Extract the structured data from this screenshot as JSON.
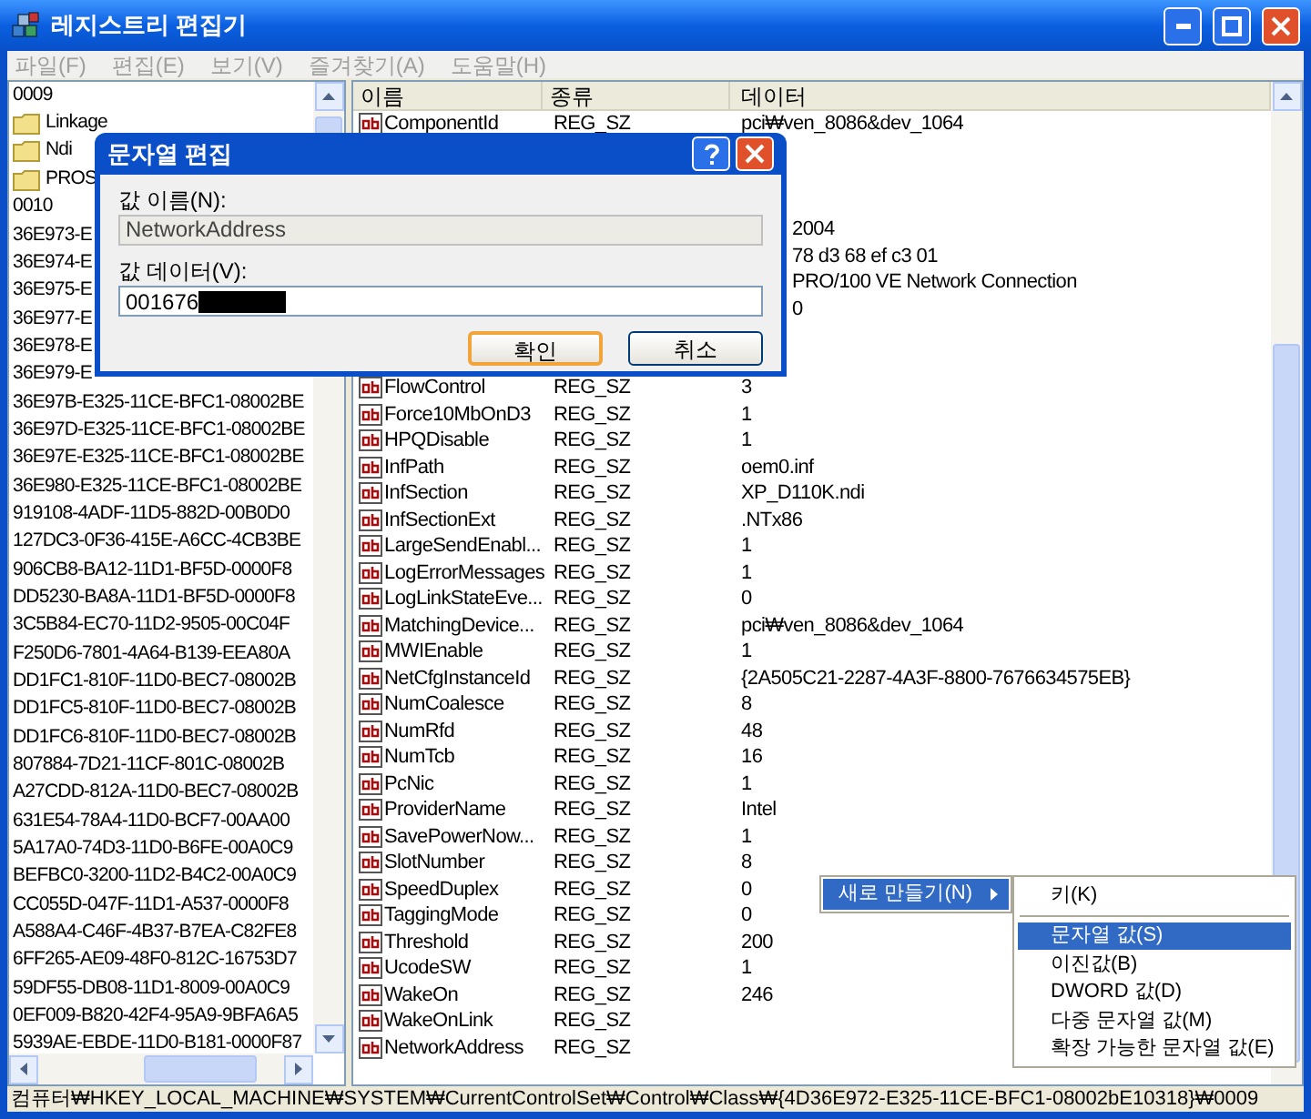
{
  "window": {
    "title": "레지스트리 편집기"
  },
  "menu_bar": [
    {
      "label": "파일(F)",
      "disabled": true
    },
    {
      "label": "편집(E)",
      "disabled": true
    },
    {
      "label": "보기(V)",
      "disabled": true
    },
    {
      "label": "즐겨찾기(A)",
      "disabled": true
    },
    {
      "label": "도움말(H)",
      "disabled": true
    }
  ],
  "tree": {
    "items": [
      {
        "kind": "key",
        "label": "0009"
      },
      {
        "kind": "folder",
        "label": "Linkage"
      },
      {
        "kind": "folder",
        "label": "Ndi"
      },
      {
        "kind": "folder",
        "label": "PROS"
      },
      {
        "kind": "key",
        "label": "0010"
      },
      {
        "kind": "key",
        "label": "36E973-E"
      },
      {
        "kind": "key",
        "label": "36E974-E"
      },
      {
        "kind": "key",
        "label": "36E975-E"
      },
      {
        "kind": "key",
        "label": "36E977-E"
      },
      {
        "kind": "key",
        "label": "36E978-E"
      },
      {
        "kind": "key",
        "label": "36E979-E"
      },
      {
        "kind": "key",
        "label": "36E97B-E325-11CE-BFC1-08002BE"
      },
      {
        "kind": "key",
        "label": "36E97D-E325-11CE-BFC1-08002BE"
      },
      {
        "kind": "key",
        "label": "36E97E-E325-11CE-BFC1-08002BE"
      },
      {
        "kind": "key",
        "label": "36E980-E325-11CE-BFC1-08002BE"
      },
      {
        "kind": "key",
        "label": "919108-4ADF-11D5-882D-00B0D0"
      },
      {
        "kind": "key",
        "label": "127DC3-0F36-415E-A6CC-4CB3BE"
      },
      {
        "kind": "key",
        "label": "906CB8-BA12-11D1-BF5D-0000F8"
      },
      {
        "kind": "key",
        "label": "DD5230-BA8A-11D1-BF5D-0000F8"
      },
      {
        "kind": "key",
        "label": "3C5B84-EC70-11D2-9505-00C04F"
      },
      {
        "kind": "key",
        "label": "F250D6-7801-4A64-B139-EEA80A"
      },
      {
        "kind": "key",
        "label": "DD1FC1-810F-11D0-BEC7-08002B"
      },
      {
        "kind": "key",
        "label": "DD1FC5-810F-11D0-BEC7-08002B"
      },
      {
        "kind": "key",
        "label": "DD1FC6-810F-11D0-BEC7-08002B"
      },
      {
        "kind": "key",
        "label": "807884-7D21-11CF-801C-08002B"
      },
      {
        "kind": "key",
        "label": "A27CDD-812A-11D0-BEC7-08002B"
      },
      {
        "kind": "key",
        "label": "631E54-78A4-11D0-BCF7-00AA00"
      },
      {
        "kind": "key",
        "label": "5A17A0-74D3-11D0-B6FE-00A0C9"
      },
      {
        "kind": "key",
        "label": "BEFBC0-3200-11D2-B4C2-00A0C9"
      },
      {
        "kind": "key",
        "label": "CC055D-047F-11D1-A537-0000F8"
      },
      {
        "kind": "key",
        "label": "A588A4-C46F-4B37-B7EA-C82FE8"
      },
      {
        "kind": "key",
        "label": "6FF265-AE09-48F0-812C-16753D7"
      },
      {
        "kind": "key",
        "label": "59DF55-DB08-11D1-8009-00A0C9"
      },
      {
        "kind": "key",
        "label": "0EF009-B820-42F4-95A9-9BFA6A5"
      },
      {
        "kind": "key",
        "label": "5939AE-EBDE-11D0-B181-0000F87"
      }
    ]
  },
  "values": {
    "columns": [
      "이름",
      "종류",
      "데이터"
    ],
    "rows": [
      {
        "kind": "value",
        "name": "ComponentId",
        "type": "REG_SZ",
        "data": "pci₩ven_8086&dev_1064"
      },
      {
        "kind": "covered"
      },
      {
        "kind": "covered"
      },
      {
        "kind": "covered"
      },
      {
        "kind": "partial",
        "data": "2004"
      },
      {
        "kind": "partial",
        "data": "78 d3 68 ef c3 01"
      },
      {
        "kind": "partial",
        "data": "PRO/100 VE Network Connection"
      },
      {
        "kind": "partial",
        "data": "0"
      },
      {
        "kind": "covered"
      },
      {
        "kind": "covered"
      },
      {
        "kind": "value",
        "name": "FlowControl",
        "type": "REG_SZ",
        "data": "3"
      },
      {
        "kind": "value",
        "name": "Force10MbOnD3",
        "type": "REG_SZ",
        "data": "1"
      },
      {
        "kind": "value",
        "name": "HPQDisable",
        "type": "REG_SZ",
        "data": "1"
      },
      {
        "kind": "value",
        "name": "InfPath",
        "type": "REG_SZ",
        "data": "oem0.inf"
      },
      {
        "kind": "value",
        "name": "InfSection",
        "type": "REG_SZ",
        "data": "XP_D110K.ndi"
      },
      {
        "kind": "value",
        "name": "InfSectionExt",
        "type": "REG_SZ",
        "data": ".NTx86"
      },
      {
        "kind": "value",
        "name": "LargeSendEnabl...",
        "type": "REG_SZ",
        "data": "1"
      },
      {
        "kind": "value",
        "name": "LogErrorMessages",
        "type": "REG_SZ",
        "data": "1"
      },
      {
        "kind": "value",
        "name": "LogLinkStateEve...",
        "type": "REG_SZ",
        "data": "0"
      },
      {
        "kind": "value",
        "name": "MatchingDevice...",
        "type": "REG_SZ",
        "data": "pci₩ven_8086&dev_1064"
      },
      {
        "kind": "value",
        "name": "MWIEnable",
        "type": "REG_SZ",
        "data": "1"
      },
      {
        "kind": "value",
        "name": "NetCfgInstanceId",
        "type": "REG_SZ",
        "data": "{2A505C21-2287-4A3F-8800-7676634575EB}"
      },
      {
        "kind": "value",
        "name": "NumCoalesce",
        "type": "REG_SZ",
        "data": "8"
      },
      {
        "kind": "value",
        "name": "NumRfd",
        "type": "REG_SZ",
        "data": "48"
      },
      {
        "kind": "value",
        "name": "NumTcb",
        "type": "REG_SZ",
        "data": "16"
      },
      {
        "kind": "value",
        "name": "PcNic",
        "type": "REG_SZ",
        "data": "1"
      },
      {
        "kind": "value",
        "name": "ProviderName",
        "type": "REG_SZ",
        "data": "Intel"
      },
      {
        "kind": "value",
        "name": "SavePowerNow...",
        "type": "REG_SZ",
        "data": "1"
      },
      {
        "kind": "value",
        "name": "SlotNumber",
        "type": "REG_SZ",
        "data": "8"
      },
      {
        "kind": "value",
        "name": "SpeedDuplex",
        "type": "REG_SZ",
        "data": "0"
      },
      {
        "kind": "value",
        "name": "TaggingMode",
        "type": "REG_SZ",
        "data": "0"
      },
      {
        "kind": "value",
        "name": "Threshold",
        "type": "REG_SZ",
        "data": "200"
      },
      {
        "kind": "value",
        "name": "UcodeSW",
        "type": "REG_SZ",
        "data": "1"
      },
      {
        "kind": "value",
        "name": "WakeOn",
        "type": "REG_SZ",
        "data": "246"
      },
      {
        "kind": "value",
        "name": "WakeOnLink",
        "type": "REG_SZ"
      },
      {
        "kind": "value",
        "name": "NetworkAddress",
        "type": "REG_SZ"
      }
    ]
  },
  "dialog": {
    "title": "문자열 편집",
    "name_label": "값 이름(N):",
    "name_value": "NetworkAddress",
    "data_label": "값 데이터(V):",
    "data_value": "001676",
    "data_redacted": true,
    "buttons": [
      {
        "label": "확인",
        "default": true
      },
      {
        "label": "취소",
        "default": false
      }
    ]
  },
  "context_menu": {
    "items": [
      {
        "label": "새로 만들기(N)",
        "selected": true,
        "submenu": true
      }
    ],
    "submenu": [
      {
        "kind": "item",
        "label": "키(K)",
        "selected": false
      },
      {
        "kind": "separator"
      },
      {
        "kind": "item",
        "label": "문자열 값(S)",
        "selected": true
      },
      {
        "kind": "item",
        "label": "이진값(B)",
        "selected": false
      },
      {
        "kind": "item",
        "label": "DWORD 값(D)",
        "selected": false
      },
      {
        "kind": "item",
        "label": "다중 문자열 값(M)",
        "selected": false
      },
      {
        "kind": "item",
        "label": "확장 가능한 문자열 값(E)",
        "selected": false
      }
    ]
  },
  "status_bar": "컴퓨터₩HKEY_LOCAL_MACHINE₩SYSTEM₩CurrentControlSet₩Control₩Class₩{4D36E972-E325-11CE-BFC1-08002bE10318}₩0009"
}
